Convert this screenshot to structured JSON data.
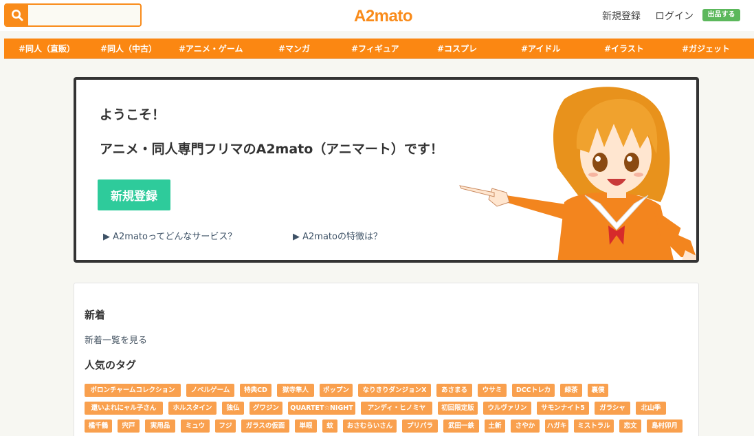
{
  "header": {
    "search_placeholder": "",
    "logo": "A2mato",
    "signup_label": "新規登録",
    "login_label": "ログイン",
    "sell_label": "出品する"
  },
  "nav": [
    "#同人（直販）",
    "#同人（中古）",
    "#アニメ・ゲーム",
    "#マンガ",
    "#フィギュア",
    "#コスプレ",
    "#アイドル",
    "#イラスト",
    "#ガジェット"
  ],
  "hero": {
    "welcome": "ようこそ！",
    "tagline": "アニメ・同人専門フリマのA2mato（アニマート）です！",
    "signup_button": "新規登録",
    "link_service": "▶ A2matoってどんなサービス？",
    "link_features": "▶ A2matoの特徴は？"
  },
  "content": {
    "new_title": "新着",
    "new_more": "新着一覧を見る",
    "tags_title": "人気のタグ",
    "tag_rows": [
      [
        "ポロンチャームコレクション",
        "ノベルゲーム",
        "特典CD",
        "獄寺隼人",
        "ポップン",
        "なりきりダンジョンX",
        "あさまる",
        "ウサミ",
        "DCCトレカ",
        "緑茶",
        "裏僕"
      ],
      [
        "還いよれにャル子さん",
        "ホルスタイン",
        "独仏",
        "グワジン",
        "QUARTET☆NIGHT",
        "アンディ・ヒノミヤ",
        "初回限定版",
        "ウルヴァリン",
        "サモンナイト5",
        "ガラシャ",
        "北山季"
      ],
      [
        "橘千鶴",
        "宍戸",
        "実用品",
        "ミュウ",
        "フジ",
        "ガラスの仮面",
        "単眼",
        "蚊",
        "おさむらいさん",
        "プリパラ",
        "武田一鉄",
        "土新",
        "さやか",
        "ハガキ",
        "ミストラル",
        "恋文",
        "島村卯月"
      ]
    ]
  },
  "colors": {
    "brand_orange": "#fb8712",
    "signup_green": "#2ecb9b",
    "sell_green": "#5cb85c",
    "tag_orange": "#f9a04e"
  },
  "icons": {
    "search": "search-icon",
    "mascot": "mascot-illustration"
  }
}
